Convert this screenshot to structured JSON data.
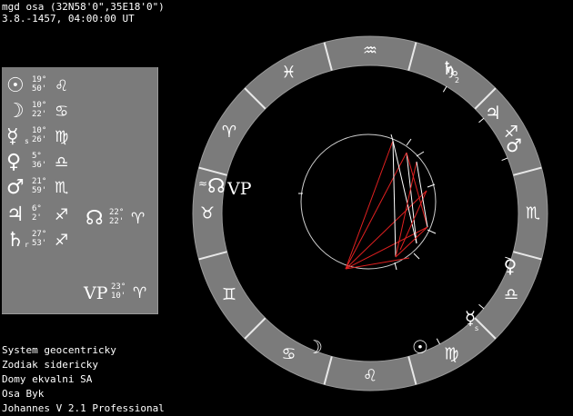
{
  "header": {
    "line1": "mgd osa (32N58'0\",35E18'0\")",
    "line2": "3.8.-1457, 04:00:00 UT"
  },
  "planets": [
    {
      "id": "sun",
      "glyph": "☉",
      "sub": "",
      "deg": "19°",
      "min": "50'",
      "sign": "♌"
    },
    {
      "id": "moon",
      "glyph": "☽",
      "sub": "",
      "deg": "10°",
      "min": "22'",
      "sign": "♋"
    },
    {
      "id": "mercury",
      "glyph": "☿",
      "sub": "s",
      "deg": "10°",
      "min": "26'",
      "sign": "♍"
    },
    {
      "id": "venus",
      "glyph": "♀",
      "sub": "",
      "deg": "5°",
      "min": "36'",
      "sign": "♎"
    },
    {
      "id": "mars",
      "glyph": "♂",
      "sub": "",
      "deg": "21°",
      "min": "59'",
      "sign": "♏"
    },
    {
      "id": "jupiter",
      "glyph": "♃",
      "sub": "",
      "deg": "6°",
      "min": "2'",
      "sign": "♐"
    },
    {
      "id": "saturn",
      "glyph": "♄",
      "sub": "r",
      "deg": "27°",
      "min": "53'",
      "sign": "♐"
    }
  ],
  "node": {
    "glyph": "☊",
    "deg": "22°",
    "min": "22'",
    "sign": "♈"
  },
  "vertex": {
    "glyph": "VP",
    "deg": "23°",
    "min": "10'",
    "sign": "♈"
  },
  "chart_ring_signs": [
    "♒",
    "♑",
    "♐",
    "♏",
    "♎",
    "♍",
    "♌",
    "♋",
    "♊",
    "♉",
    "♈",
    "♓"
  ],
  "chart_labels": {
    "saturn": "♄",
    "saturn_sub": "2",
    "jupiter": "♃",
    "mars": "♂",
    "venus": "♀",
    "mercury": "☿",
    "mercury_sub": "s",
    "sun": "☉",
    "moon": "☽",
    "node_vp_prefix": "≈",
    "node_vp_node": "☊",
    "node_vp_vp": "VP"
  },
  "footer": {
    "line1": "System geocentricky",
    "line2": "Zodiak sidericky",
    "line3": "Domy ekvalni SA",
    "line4": "Osa Byk",
    "line5": "Johannes V 2.1 Professional"
  }
}
